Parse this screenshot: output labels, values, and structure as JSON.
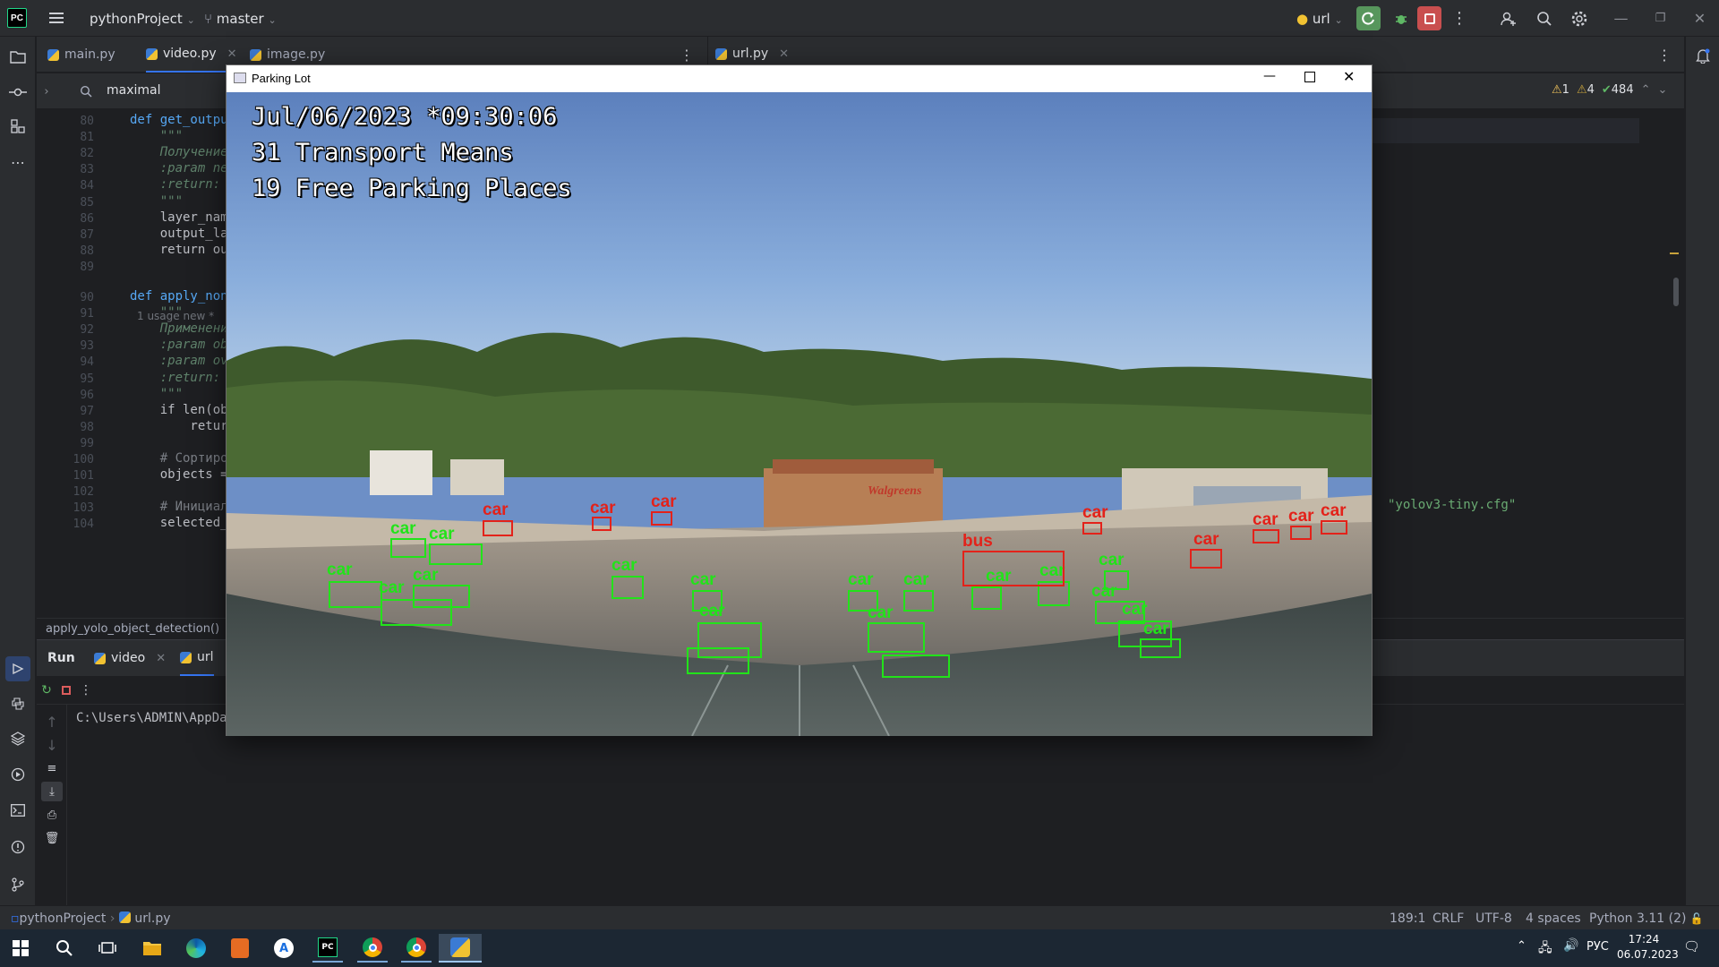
{
  "ide": {
    "project": "pythonProject",
    "branch": "master",
    "run_config": "url",
    "editor_tabs": [
      "main.py",
      "video.py",
      "image.py"
    ],
    "right_tabs": [
      "url.py"
    ],
    "search_query": "maximal",
    "inspections": {
      "warnings": "1",
      "weak": "4",
      "ok": "484"
    },
    "lines": [
      {
        "n": "80",
        "t": "def get_output_la"
      },
      {
        "n": "81",
        "t": "    \"\"\""
      },
      {
        "n": "82",
        "t": "    Получение имен"
      },
      {
        "n": "83",
        "t": "    :param net: н"
      },
      {
        "n": "84",
        "t": "    :return: имен"
      },
      {
        "n": "85",
        "t": "    \"\"\""
      },
      {
        "n": "86",
        "t": "    layer_names ="
      },
      {
        "n": "87",
        "t": "    output_layers"
      },
      {
        "n": "88",
        "t": "    return output_"
      },
      {
        "n": "89",
        "t": ""
      },
      {
        "n": "90",
        "t": "def apply_non_max"
      },
      {
        "n": "91",
        "t": "    \"\"\""
      },
      {
        "n": "92",
        "t": "    Применение ал"
      },
      {
        "n": "93",
        "t": "    :param object"
      },
      {
        "n": "94",
        "t": "    :param overla"
      },
      {
        "n": "95",
        "t": "    :return: отфи"
      },
      {
        "n": "96",
        "t": "    \"\"\""
      },
      {
        "n": "97",
        "t": "    if len(object"
      },
      {
        "n": "98",
        "t": "        return []"
      },
      {
        "n": "99",
        "t": ""
      },
      {
        "n": "100",
        "t": "    # Сортировка"
      },
      {
        "n": "101",
        "t": "    objects = sor"
      },
      {
        "n": "102",
        "t": ""
      },
      {
        "n": "103",
        "t": "    # Инициализац"
      },
      {
        "n": "104",
        "t": "    selected_obje"
      }
    ],
    "usage_hint": "1 usage   new *",
    "right_code_fragment": "\"yolov3-tiny.cfg\"",
    "breadcrumb": "apply_yolo_object_detection()",
    "run_label": "Run",
    "run_tabs": [
      "video",
      "url"
    ],
    "console_line": "C:\\Users\\ADMIN\\AppDat",
    "status": {
      "project": "pythonProject",
      "file": "url.py",
      "position": "189:1",
      "line_sep": "CRLF",
      "encoding": "UTF-8",
      "indent": "4 spaces",
      "interpreter": "Python 3.11 (2)"
    }
  },
  "video_window": {
    "title": "Parking Lot",
    "timestamp": "Jul/06/2023 *09:30:06",
    "transport": "31 Transport Means",
    "free": "19 Free Parking Places",
    "detections": [
      {
        "label": "car",
        "color": "green"
      },
      {
        "label": "car",
        "color": "green"
      },
      {
        "label": "car",
        "color": "green"
      },
      {
        "label": "car",
        "color": "green"
      },
      {
        "label": "car",
        "color": "green"
      },
      {
        "label": "car",
        "color": "green"
      },
      {
        "label": "car",
        "color": "green"
      },
      {
        "label": "car",
        "color": "green"
      },
      {
        "label": "car",
        "color": "green"
      },
      {
        "label": "car",
        "color": "green"
      },
      {
        "label": "car",
        "color": "green"
      },
      {
        "label": "car",
        "color": "green"
      },
      {
        "label": "car",
        "color": "green"
      },
      {
        "label": "car",
        "color": "green"
      },
      {
        "label": "car",
        "color": "green"
      },
      {
        "label": "car",
        "color": "green"
      },
      {
        "label": "car",
        "color": "green"
      },
      {
        "label": "car",
        "color": "red"
      },
      {
        "label": "car",
        "color": "red"
      },
      {
        "label": "car",
        "color": "red"
      },
      {
        "label": "car",
        "color": "red"
      },
      {
        "label": "car",
        "color": "red"
      },
      {
        "label": "car",
        "color": "red"
      },
      {
        "label": "car",
        "color": "red"
      },
      {
        "label": "car",
        "color": "red"
      },
      {
        "label": "bus",
        "color": "red"
      }
    ],
    "store_sign": "Walgreens"
  },
  "taskbar": {
    "language": "РУС",
    "time": "17:24",
    "date": "06.07.2023"
  },
  "colors": {
    "accent": "#3574f0",
    "box_green": "#22e31a",
    "box_red": "#e3221a"
  }
}
